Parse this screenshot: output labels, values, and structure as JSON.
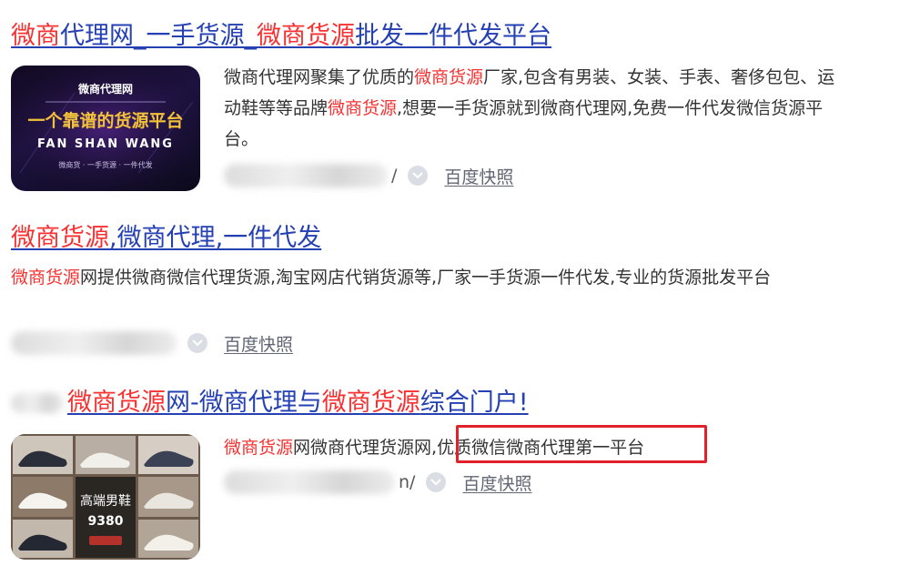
{
  "results": [
    {
      "title_parts": [
        {
          "text": "微商",
          "hl": true
        },
        {
          "text": "代理网_一手货源_",
          "hl": false
        },
        {
          "text": "微商货源",
          "hl": true
        },
        {
          "text": "批发一件代发平台",
          "hl": false
        }
      ],
      "thumb": {
        "brand": "微商代理网",
        "tagline": "一个靠谱的货源平台",
        "english": "FAN SHAN WANG",
        "footer": "微商货 · 一手货源 · 一件代发"
      },
      "desc_parts": [
        {
          "text": "微商代理网聚集了优质的",
          "hl": false
        },
        {
          "text": "微商货源",
          "hl": true
        },
        {
          "text": "厂家,包含有男装、女装、手表、奢侈包包、运动鞋等等品牌",
          "hl": false
        },
        {
          "text": "微商货源",
          "hl": true
        },
        {
          "text": ",想要一手货源就到微商代理网,免费一件代发微信货源平台。",
          "hl": false
        }
      ],
      "url_suffix": "/",
      "cache_label": "百度快照"
    },
    {
      "title_parts": [
        {
          "text": "微商货源",
          "hl": true
        },
        {
          "text": ",微商代理,一件代发",
          "hl": false
        }
      ],
      "desc_parts": [
        {
          "text": "微商货源",
          "hl": true
        },
        {
          "text": "网提供微商微信代理货源,淘宝网店代销货源等,厂家一手货源一件代发,专业的货源批发平台",
          "hl": false
        }
      ],
      "url_suffix": "/",
      "cache_label": "百度快照"
    },
    {
      "title_parts": [
        {
          "text": "微商货源",
          "hl": true
        },
        {
          "text": "网-微商代理与",
          "hl": false
        },
        {
          "text": "微商货源",
          "hl": true
        },
        {
          "text": "综合门户!",
          "hl": false
        }
      ],
      "thumb": {
        "label": "高端男鞋",
        "price": "9380"
      },
      "desc_parts": [
        {
          "text": "微商货源",
          "hl": true
        },
        {
          "text": "网微商代理货源网,",
          "hl": false
        },
        {
          "text": "优质微信微商代理第一平台",
          "hl": false
        }
      ],
      "url_suffix": "n/",
      "cache_label": "百度快照"
    }
  ],
  "colors": {
    "title": "#2440b3",
    "highlight": "#f73131",
    "text": "#333333",
    "meta": "#626675",
    "box": "#e0202a"
  }
}
